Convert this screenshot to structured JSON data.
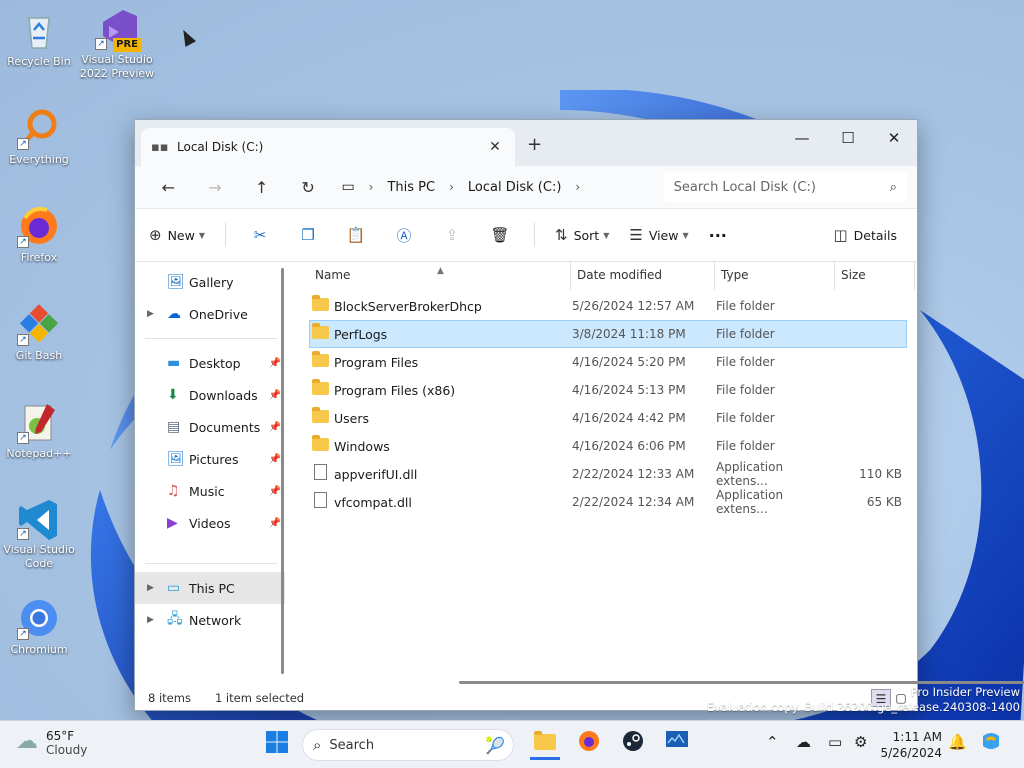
{
  "desktop": {
    "icons": [
      {
        "label": "Recycle Bin",
        "icon": "recycle-bin-icon"
      },
      {
        "label": "Visual Studio 2022 Preview",
        "icon": "visual-studio-icon",
        "badge": "PRE"
      },
      {
        "label": "Everything",
        "icon": "everything-search-icon"
      },
      {
        "label": "Firefox",
        "icon": "firefox-icon"
      },
      {
        "label": "Git Bash",
        "icon": "git-bash-icon"
      },
      {
        "label": "Notepad++",
        "icon": "notepadpp-icon"
      },
      {
        "label": "Visual Studio Code",
        "icon": "vscode-icon"
      },
      {
        "label": "Chromium",
        "icon": "chromium-icon"
      }
    ],
    "watermark_line1": "Pro Insider Preview",
    "watermark_line2": "Evaluation copy. Build 26200.ge_release.240308-1400"
  },
  "explorer": {
    "tab_title": "Local Disk (C:)",
    "new_tab_label": "+",
    "breadcrumb": [
      "This PC",
      "Local Disk (C:)"
    ],
    "search_placeholder": "Search Local Disk (C:)",
    "toolbar": {
      "new_label": "New",
      "sort_label": "Sort",
      "view_label": "View",
      "more_label": "···",
      "details_label": "Details"
    },
    "sidebar": {
      "top": [
        {
          "label": "Gallery",
          "icon": "gallery-icon",
          "expand": false
        },
        {
          "label": "OneDrive",
          "icon": "onedrive-icon",
          "expand": true
        }
      ],
      "quick": [
        {
          "label": "Desktop",
          "icon": "desktop-icon"
        },
        {
          "label": "Downloads",
          "icon": "downloads-icon"
        },
        {
          "label": "Documents",
          "icon": "documents-icon"
        },
        {
          "label": "Pictures",
          "icon": "pictures-icon"
        },
        {
          "label": "Music",
          "icon": "music-icon"
        },
        {
          "label": "Videos",
          "icon": "videos-icon"
        }
      ],
      "bottom": [
        {
          "label": "This PC",
          "icon": "this-pc-icon",
          "selected": true
        },
        {
          "label": "Network",
          "icon": "network-icon",
          "selected": false
        }
      ]
    },
    "columns": {
      "name": "Name",
      "date": "Date modified",
      "type": "Type",
      "size": "Size"
    },
    "files": [
      {
        "name": "BlockServerBrokerDhcp",
        "date": "5/26/2024 12:57 AM",
        "type": "File folder",
        "size": "",
        "kind": "folder"
      },
      {
        "name": "PerfLogs",
        "date": "3/8/2024 11:18 PM",
        "type": "File folder",
        "size": "",
        "kind": "folder",
        "selected": true
      },
      {
        "name": "Program Files",
        "date": "4/16/2024 5:20 PM",
        "type": "File folder",
        "size": "",
        "kind": "folder"
      },
      {
        "name": "Program Files (x86)",
        "date": "4/16/2024 5:13 PM",
        "type": "File folder",
        "size": "",
        "kind": "folder"
      },
      {
        "name": "Users",
        "date": "4/16/2024 4:42 PM",
        "type": "File folder",
        "size": "",
        "kind": "folder"
      },
      {
        "name": "Windows",
        "date": "4/16/2024 6:06 PM",
        "type": "File folder",
        "size": "",
        "kind": "folder"
      },
      {
        "name": "appverifUI.dll",
        "date": "2/22/2024 12:33 AM",
        "type": "Application extens...",
        "size": "110 KB",
        "kind": "file"
      },
      {
        "name": "vfcompat.dll",
        "date": "2/22/2024 12:34 AM",
        "type": "Application extens...",
        "size": "65 KB",
        "kind": "file"
      }
    ],
    "status": {
      "count": "8 items",
      "selection": "1 item selected"
    }
  },
  "taskbar": {
    "weather_temp": "65°F",
    "weather_desc": "Cloudy",
    "search_label": "Search",
    "time": "1:11 AM",
    "date": "5/26/2024"
  }
}
